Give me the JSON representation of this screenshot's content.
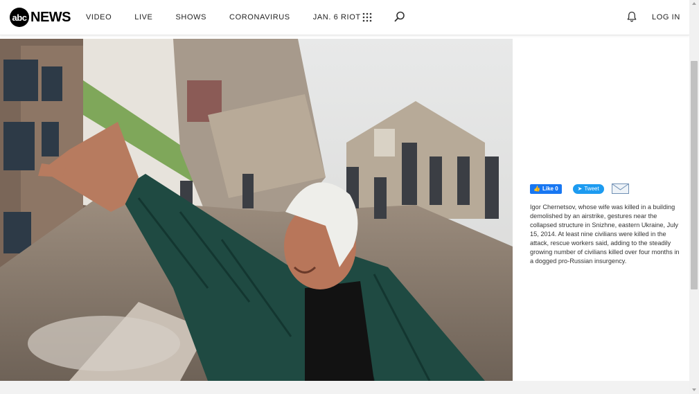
{
  "header": {
    "logo_mark": "abc",
    "logo_word": "NEWS",
    "nav": [
      "VIDEO",
      "LIVE",
      "SHOWS",
      "CORONAVIRUS",
      "JAN. 6 RIOT"
    ],
    "login_label": "LOG IN",
    "icons": [
      "grid-icon",
      "search-icon",
      "bell-icon"
    ]
  },
  "photo": {
    "description_icon": "photo"
  },
  "share": {
    "like_label": "Like 0",
    "tweet_label": "Tweet",
    "icons": [
      "facebook-thumb-icon",
      "twitter-bird-icon",
      "mail-icon"
    ]
  },
  "caption": "Igor Chernetsov, whose wife was killed in a building demolished by an airstrike, gestures near the collapsed structure in Snizhne, eastern Ukraine, July 15, 2014. At least nine civilians were killed in the attack, rescue workers said, adding to the steadily growing number of civilians killed over four months in a dogged pro-Russian insurgency.",
  "colors": {
    "facebook": "#1877f2",
    "twitter": "#1d9bf0"
  }
}
